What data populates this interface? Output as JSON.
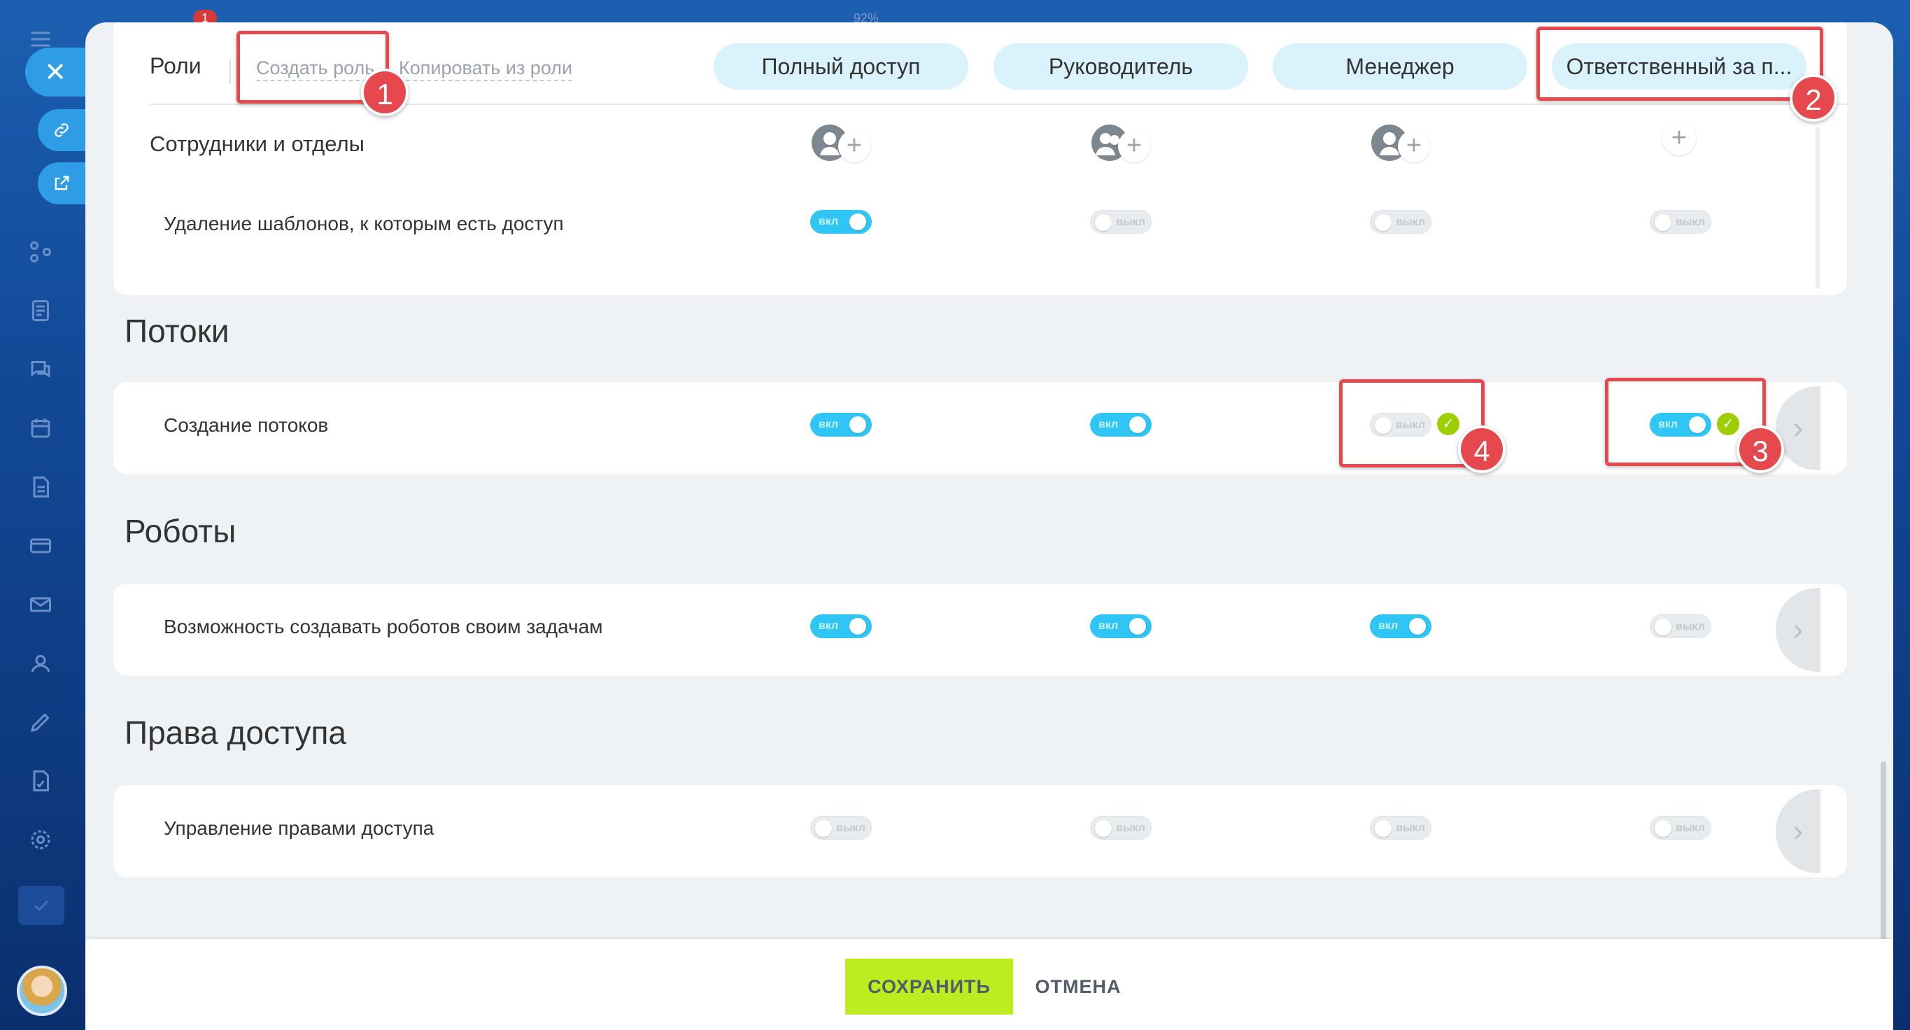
{
  "chrome": {
    "notification_count": "1",
    "zoom": "92%"
  },
  "header": {
    "roles_label": "Роли",
    "create_role": "Создать роль",
    "copy_from_role": "Копировать из роли",
    "role_columns": [
      "Полный доступ",
      "Руководитель",
      "Менеджер",
      "Ответственный за п..."
    ]
  },
  "toggle_text": {
    "on": "вкл",
    "off": "выкл"
  },
  "sections": {
    "top": {
      "employees_label": "Сотрудники и отделы",
      "delete_templates_label": "Удаление шаблонов, к которым есть доступ",
      "delete_templates_states": [
        true,
        false,
        false,
        false
      ]
    },
    "flows": {
      "title": "Потоки",
      "row_label": "Создание потоков",
      "states": [
        true,
        true,
        false,
        true
      ]
    },
    "robots": {
      "title": "Роботы",
      "row_label": "Возможность создавать роботов своим задачам",
      "states": [
        true,
        true,
        true,
        false
      ]
    },
    "access": {
      "title": "Права доступа",
      "row_label": "Управление правами доступа",
      "states": [
        false,
        false,
        false,
        false
      ]
    }
  },
  "footer": {
    "save": "СОХРАНИТЬ",
    "cancel": "ОТМЕНА"
  },
  "annotations": [
    "1",
    "2",
    "3",
    "4"
  ],
  "colors": {
    "accent_toggle": "#2fc6f6",
    "save_button": "#bbed21",
    "callout": "#e5484d",
    "role_pill": "#d9f2fb"
  }
}
